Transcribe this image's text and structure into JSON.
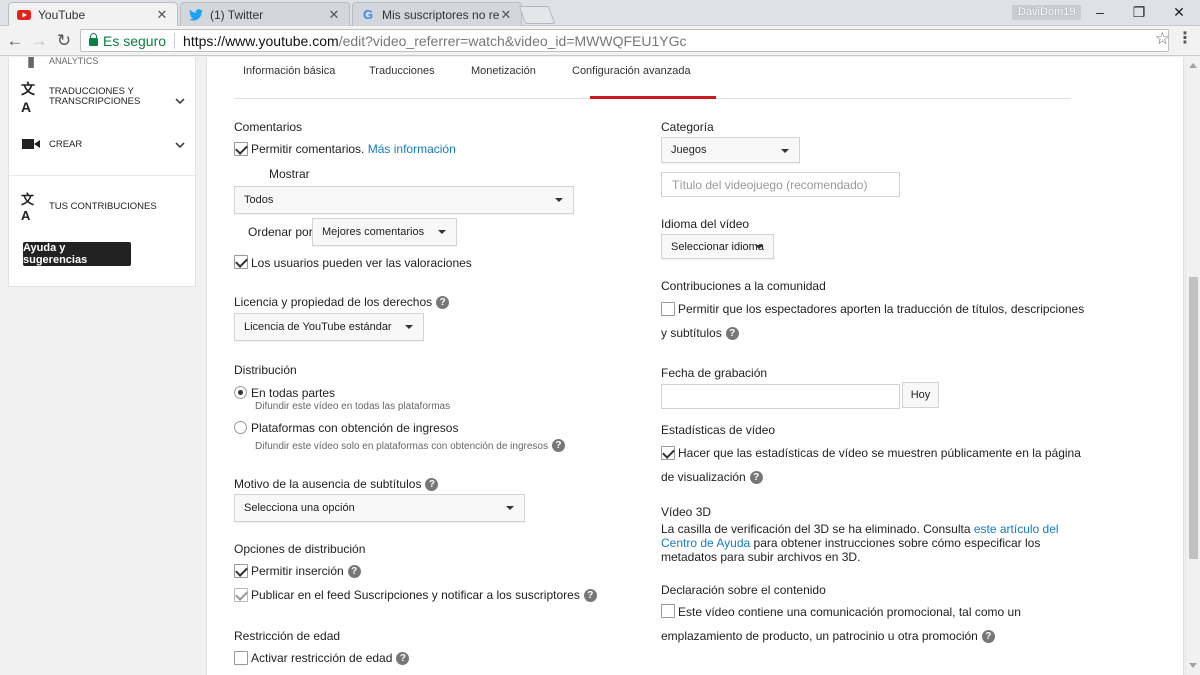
{
  "browser": {
    "tabs": [
      {
        "title": "YouTube",
        "icon": "youtube-icon"
      },
      {
        "title": "(1) Twitter",
        "icon": "twitter-icon"
      },
      {
        "title": "Mis suscriptores no recib",
        "icon": "google-icon"
      }
    ],
    "user": "DaviDom19",
    "secure_label": "Es seguro",
    "url_host": "https://www.youtube.com",
    "url_path": "/edit?video_referrer=watch&video_id=MWWQFEU1YGc"
  },
  "sidebar": {
    "cut_item": "ANALYTICS",
    "items": [
      {
        "label_line1": "TRADUCCIONES Y",
        "label_line2": "TRANSCRIPCIONES",
        "icon": "translate-icon"
      },
      {
        "label": "CREAR",
        "icon": "camera-icon"
      },
      {
        "label": "TUS CONTRIBUCIONES",
        "icon": "translate-icon"
      }
    ],
    "help_button": "Ayuda y sugerencias"
  },
  "tabs": [
    "Información básica",
    "Traducciones",
    "Monetización",
    "Configuración avanzada"
  ],
  "active_tab": "Configuración avanzada",
  "left": {
    "comments": {
      "heading": "Comentarios",
      "allow_label": "Permitir comentarios.",
      "more_info": "Más información",
      "allow_checked": true,
      "show_label": "Mostrar",
      "show_value": "Todos",
      "order_label": "Ordenar por",
      "order_value": "Mejores comentarios",
      "ratings_label": "Los usuarios pueden ver las valoraciones",
      "ratings_checked": true
    },
    "license": {
      "heading": "Licencia y propiedad de los derechos",
      "value": "Licencia de YouTube estándar"
    },
    "distribution": {
      "heading": "Distribución",
      "opt1": "En todas partes",
      "opt1_sub": "Difundir este vídeo en todas las plataformas",
      "opt2": "Plataformas con obtención de ingresos",
      "opt2_sub": "Difundir este vídeo solo en plataformas con obtención de ingresos",
      "selected": "En todas partes"
    },
    "subtitles": {
      "heading": "Motivo de la ausencia de subtítulos",
      "value": "Selecciona una opción"
    },
    "dist_options": {
      "heading": "Opciones de distribución",
      "embed_label": "Permitir inserción",
      "embed_checked": true,
      "feed_label": "Publicar en el feed Suscripciones y notificar a los suscriptores",
      "feed_checked": true
    },
    "age": {
      "heading": "Restricción de edad",
      "label": "Activar restricción de edad",
      "checked": false
    }
  },
  "right": {
    "category": {
      "heading": "Categoría",
      "value": "Juegos",
      "game_placeholder": "Título del videojuego (recomendado)"
    },
    "language": {
      "heading": "Idioma del vídeo",
      "value": "Seleccionar idioma"
    },
    "community": {
      "heading": "Contribuciones a la comunidad",
      "label_line1": "Permitir que los espectadores aporten la traducción de títulos, descripciones",
      "label_line2": "y subtítulos",
      "checked": false
    },
    "recording": {
      "heading": "Fecha de grabación",
      "today_button": "Hoy"
    },
    "stats": {
      "heading": "Estadísticas de vídeo",
      "label_line1": "Hacer que las estadísticas de vídeo se muestren públicamente en la página",
      "label_line2": "de visualización",
      "checked": true
    },
    "video3d": {
      "heading": "Vídeo 3D",
      "line1_text": "La casilla de verificación del 3D se ha eliminado. Consulta",
      "line1_link": "este artículo del",
      "line2_link": "Centro de Ayuda",
      "line2_text": "para obtener instrucciones sobre cómo especificar los",
      "line3_text": "metadatos para subir archivos en 3D."
    },
    "content_declaration": {
      "heading": "Declaración sobre el contenido",
      "label_line1": "Este vídeo contiene una comunicación promocional, tal como un",
      "label_line2": "emplazamiento de producto, un patrocinio u otra promoción",
      "checked": false
    }
  },
  "colors": {
    "accent_red": "#cc181e",
    "link_blue": "#167ac6",
    "secure_green": "#0b8043"
  }
}
